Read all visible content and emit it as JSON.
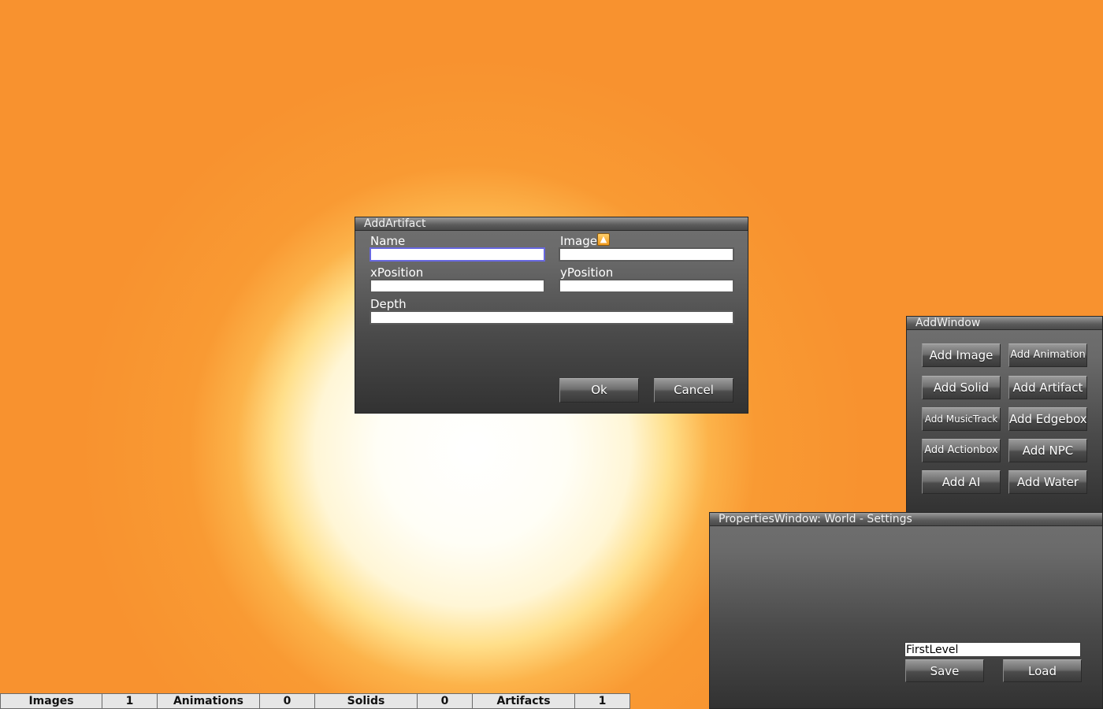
{
  "add_artifact": {
    "title": "AddArtifact",
    "name_label": "Name",
    "name_value": "",
    "image_label": "Image",
    "image_icon": "image-picker-icon",
    "image_value": "",
    "xposition_label": "xPosition",
    "xposition_value": "",
    "yposition_label": "yPosition",
    "yposition_value": "",
    "depth_label": "Depth",
    "depth_value": "",
    "ok_label": "Ok",
    "cancel_label": "Cancel"
  },
  "add_window": {
    "title": "AddWindow",
    "buttons": {
      "add_image": "Add Image",
      "add_animation": "Add Animation",
      "add_solid": "Add Solid",
      "add_artifact": "Add Artifact",
      "add_musictrack": "Add MusicTrack",
      "add_edgebox": "Add Edgebox",
      "add_actionbox": "Add Actionbox",
      "add_npc": "Add NPC",
      "add_ai": "Add AI",
      "add_water": "Add Water"
    }
  },
  "properties_window": {
    "title": "PropertiesWindow: World - Settings",
    "level_name": "FirstLevel",
    "save_label": "Save",
    "load_label": "Load"
  },
  "status_bar": {
    "images_label": "Images",
    "images_count": "1",
    "animations_label": "Animations",
    "animations_count": "0",
    "solids_label": "Solids",
    "solids_count": "0",
    "artifacts_label": "Artifacts",
    "artifacts_count": "1"
  },
  "colors": {
    "background_outer": "#f8922f",
    "background_glow": "#ffffff",
    "window_body": "#4a4a4a",
    "focus_border": "#6868e0"
  }
}
